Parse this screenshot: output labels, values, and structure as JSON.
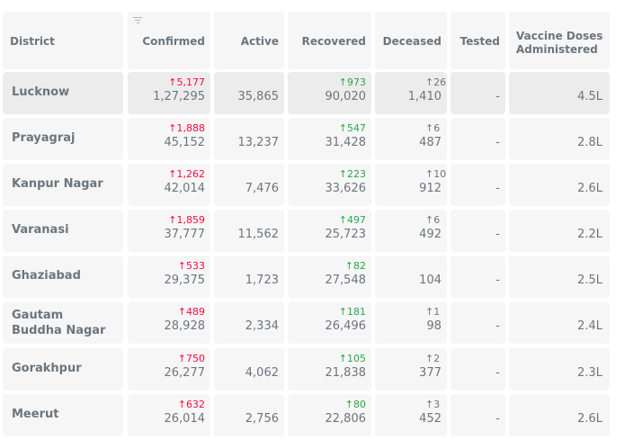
{
  "headers": {
    "district": "District",
    "confirmed": "Confirmed",
    "active": "Active",
    "recovered": "Recovered",
    "deceased": "Deceased",
    "tested": "Tested",
    "vaccine_line1": "Vaccine Doses",
    "vaccine_line2": "Administered"
  },
  "rows": [
    {
      "district_l1": "Lucknow",
      "district_l2": "",
      "confirmed_delta": "↑5,177",
      "confirmed": "1,27,295",
      "active": "35,865",
      "recovered_delta": "↑973",
      "recovered": "90,020",
      "deceased_delta": "↑26",
      "deceased": "1,410",
      "tested": "-",
      "vaccine": "4.5L"
    },
    {
      "district_l1": "Prayagraj",
      "district_l2": "",
      "confirmed_delta": "↑1,888",
      "confirmed": "45,152",
      "active": "13,237",
      "recovered_delta": "↑547",
      "recovered": "31,428",
      "deceased_delta": "↑6",
      "deceased": "487",
      "tested": "-",
      "vaccine": "2.8L"
    },
    {
      "district_l1": "Kanpur Nagar",
      "district_l2": "",
      "confirmed_delta": "↑1,262",
      "confirmed": "42,014",
      "active": "7,476",
      "recovered_delta": "↑223",
      "recovered": "33,626",
      "deceased_delta": "↑10",
      "deceased": "912",
      "tested": "-",
      "vaccine": "2.6L"
    },
    {
      "district_l1": "Varanasi",
      "district_l2": "",
      "confirmed_delta": "↑1,859",
      "confirmed": "37,777",
      "active": "11,562",
      "recovered_delta": "↑497",
      "recovered": "25,723",
      "deceased_delta": "↑6",
      "deceased": "492",
      "tested": "-",
      "vaccine": "2.2L"
    },
    {
      "district_l1": "Ghaziabad",
      "district_l2": "",
      "confirmed_delta": "↑533",
      "confirmed": "29,375",
      "active": "1,723",
      "recovered_delta": "↑82",
      "recovered": "27,548",
      "deceased_delta": "",
      "deceased": "104",
      "tested": "-",
      "vaccine": "2.5L"
    },
    {
      "district_l1": "Gautam",
      "district_l2": "Buddha Nagar",
      "confirmed_delta": "↑489",
      "confirmed": "28,928",
      "active": "2,334",
      "recovered_delta": "↑181",
      "recovered": "26,496",
      "deceased_delta": "↑1",
      "deceased": "98",
      "tested": "-",
      "vaccine": "2.4L"
    },
    {
      "district_l1": "Gorakhpur",
      "district_l2": "",
      "confirmed_delta": "↑750",
      "confirmed": "26,277",
      "active": "4,062",
      "recovered_delta": "↑105",
      "recovered": "21,838",
      "deceased_delta": "↑2",
      "deceased": "377",
      "tested": "-",
      "vaccine": "2.3L"
    },
    {
      "district_l1": "Meerut",
      "district_l2": "",
      "confirmed_delta": "↑632",
      "confirmed": "26,014",
      "active": "2,756",
      "recovered_delta": "↑80",
      "recovered": "22,806",
      "deceased_delta": "↑3",
      "deceased": "452",
      "tested": "-",
      "vaccine": "2.6L"
    }
  ],
  "colors": {
    "confirmed": "#ff073a",
    "recovered": "#28a745",
    "neutral": "#6c757d"
  },
  "icons": {
    "sort": "filter-icon"
  }
}
